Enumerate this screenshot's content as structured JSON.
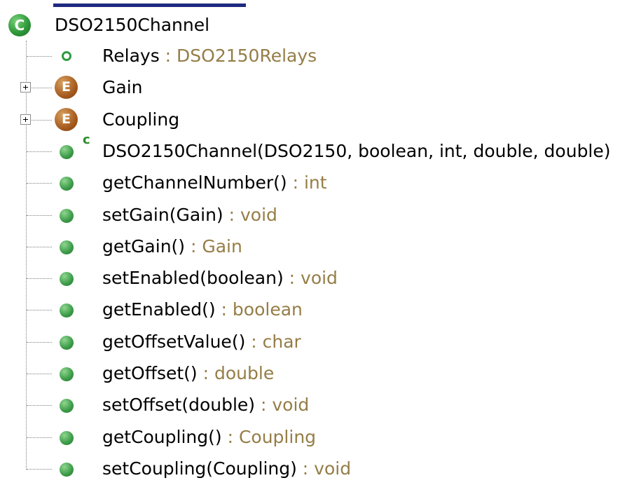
{
  "class": {
    "name": "DSO2150Channel",
    "icon": "class-icon",
    "icon_letter": "C"
  },
  "type_separator": " : ",
  "members": [
    {
      "kind": "field",
      "icon": "field-icon",
      "name": "Relays",
      "type": "DSO2150Relays"
    },
    {
      "kind": "enum",
      "icon": "enum-icon",
      "icon_letter": "E",
      "name": "Gain",
      "type": "",
      "expandable": true
    },
    {
      "kind": "enum",
      "icon": "enum-icon",
      "icon_letter": "E",
      "name": "Coupling",
      "type": "",
      "expandable": true
    },
    {
      "kind": "constructor",
      "icon": "constructor-icon",
      "ctor_badge": "c",
      "name": "DSO2150Channel(DSO2150, boolean, int, double, double)",
      "type": ""
    },
    {
      "kind": "method",
      "icon": "method-icon",
      "name": "getChannelNumber()",
      "type": "int"
    },
    {
      "kind": "method",
      "icon": "method-icon",
      "name": "setGain(Gain)",
      "type": "void"
    },
    {
      "kind": "method",
      "icon": "method-icon",
      "name": "getGain()",
      "type": "Gain"
    },
    {
      "kind": "method",
      "icon": "method-icon",
      "name": "setEnabled(boolean)",
      "type": "void"
    },
    {
      "kind": "method",
      "icon": "method-icon",
      "name": "getEnabled()",
      "type": "boolean"
    },
    {
      "kind": "method",
      "icon": "method-icon",
      "name": "getOffsetValue()",
      "type": "char"
    },
    {
      "kind": "method",
      "icon": "method-icon",
      "name": "getOffset()",
      "type": "double"
    },
    {
      "kind": "method",
      "icon": "method-icon",
      "name": "setOffset(double)",
      "type": "void"
    },
    {
      "kind": "method",
      "icon": "method-icon",
      "name": "getCoupling()",
      "type": "Coupling"
    },
    {
      "kind": "method",
      "icon": "method-icon",
      "name": "setCoupling(Coupling)",
      "type": "void"
    }
  ]
}
